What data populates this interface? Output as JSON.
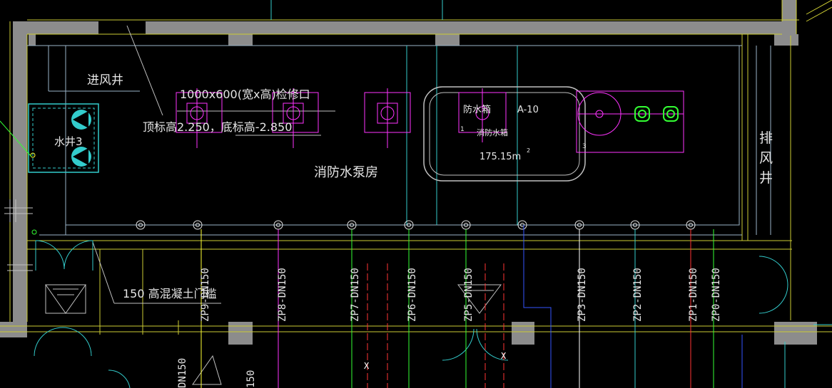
{
  "drawing": {
    "room_name": "消防水泵房",
    "intake_shaft": "进风井",
    "exhaust_shaft_chars": [
      "排",
      "风",
      "井"
    ],
    "water_well": "水井3",
    "access_hatch": "1000x600(宽x高)检修口",
    "elevation_note": "顶标高2.250，底标高-2.850",
    "curb_note": "150  高混凝土门槛",
    "tank_tag_1": "防水箱",
    "tank_tag_2": "A-10",
    "tank_tag_3": "消防水箱",
    "tank_area": "175.15m",
    "tank_area_sup": "2",
    "pump_tag": "3",
    "tank_tag_num": "1",
    "lower_left_pipe": "DN150",
    "lower_pipe_2": "150"
  },
  "risers": [
    {
      "label": "ZP9-DN150"
    },
    {
      "label": "ZP8-DN150"
    },
    {
      "label": "ZP7-DN150"
    },
    {
      "label": "ZP6-DN150"
    },
    {
      "label": "ZP5-DN150"
    },
    {
      "label": "ZP3-DN150"
    },
    {
      "label": "ZP2-DN150"
    },
    {
      "label": "ZP1-DN150"
    },
    {
      "label": "ZP0-DN150"
    }
  ],
  "colors": {
    "wall": "#8c8c8c",
    "wall_line": "#cccc33",
    "room_line": "#9ab3c9",
    "pump": "#ff33ff",
    "cyan": "#33cccc",
    "green": "#33ff33",
    "red": "#ff3333",
    "blue": "#3355ff",
    "white": "#e6e6e6"
  }
}
